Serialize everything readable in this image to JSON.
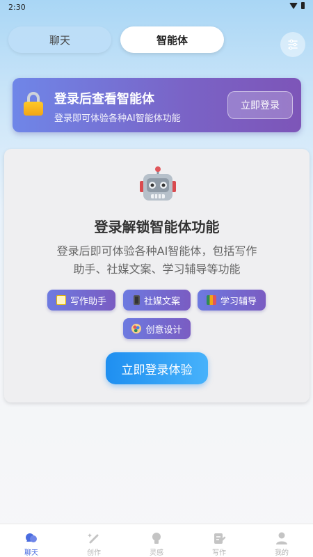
{
  "status_bar": {
    "time": "2:30"
  },
  "tabs": [
    {
      "label": "聊天",
      "active": false
    },
    {
      "label": "智能体",
      "active": true
    }
  ],
  "login_banner": {
    "title": "登录后查看智能体",
    "subtitle": "登录即可体验各种AI智能体功能",
    "button_label": "立即登录"
  },
  "unlock_card": {
    "title": "登录解锁智能体功能",
    "description": "登录后即可体验各种AI智能体，包括写作助手、社媒文案、学习辅导等功能",
    "tags": [
      {
        "label": "写作助手",
        "icon": "memo-icon"
      },
      {
        "label": "社媒文案",
        "icon": "mobile-phone-icon"
      },
      {
        "label": "学习辅导",
        "icon": "books-icon"
      },
      {
        "label": "创意设计",
        "icon": "palette-icon"
      }
    ],
    "cta_label": "立即登录体验"
  },
  "bottom_nav": [
    {
      "label": "聊天",
      "icon": "chat-icon",
      "active": true
    },
    {
      "label": "创作",
      "icon": "magic-wand-icon",
      "active": false
    },
    {
      "label": "灵感",
      "icon": "lightbulb-icon",
      "active": false
    },
    {
      "label": "写作",
      "icon": "edit-document-icon",
      "active": false
    },
    {
      "label": "我的",
      "icon": "user-icon",
      "active": false
    }
  ],
  "colors": {
    "accent": "#4a6ce0",
    "cta_blue": "#1f8ff0",
    "banner_purple": "#7a63c6"
  }
}
